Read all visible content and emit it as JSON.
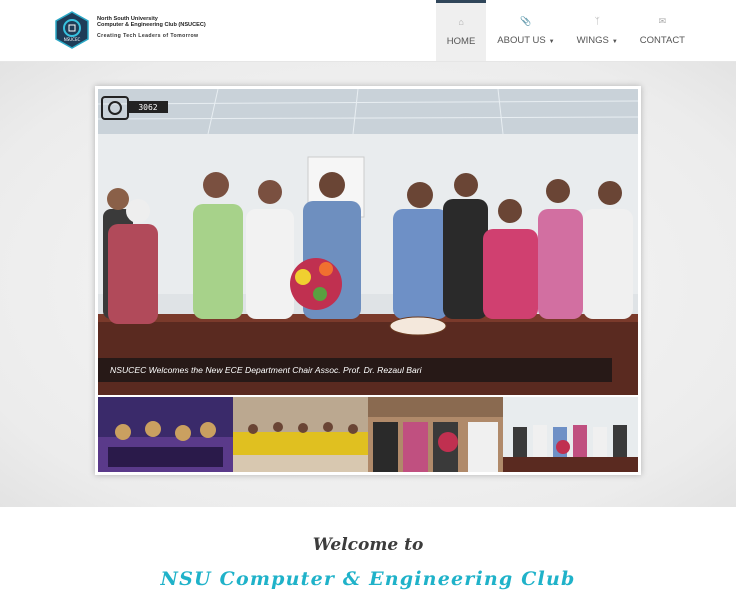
{
  "logo": {
    "badge_text": "NSUCEC",
    "line1": "North South University",
    "line2": "Computer & Engineering Club (NSUCEC)",
    "tagline": "Creating Tech Leaders of Tomorrow"
  },
  "nav": {
    "items": [
      {
        "label": "HOME",
        "icon": "home-icon",
        "active": true
      },
      {
        "label": "ABOUT US",
        "icon": "paperclip-icon",
        "dropdown": true
      },
      {
        "label": "WINGS",
        "icon": "branch-icon",
        "dropdown": true
      },
      {
        "label": "CONTACT",
        "icon": "envelope-icon"
      }
    ]
  },
  "slider": {
    "camera_badge": "3062",
    "caption": "NSUCEC Welcomes the New ECE Department Chair Assoc. Prof. Dr. Rezaul Bari",
    "thumbnails": 4
  },
  "welcome": {
    "heading": "Welcome to",
    "club_name": "NSU Computer & Engineering Club"
  },
  "colors": {
    "accent": "#1fb2c9",
    "nav_active_border": "#30465a"
  }
}
